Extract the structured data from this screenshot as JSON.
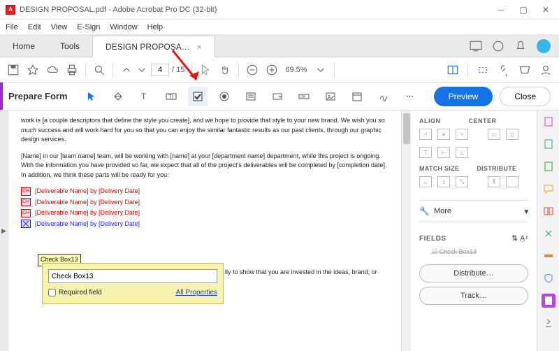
{
  "window": {
    "title": "DESIGN PROPOSAL.pdf - Adobe Acrobat Pro DC (32-bit)"
  },
  "menu": {
    "file": "File",
    "edit": "Edit",
    "view": "View",
    "esign": "E-Sign",
    "window": "Window",
    "help": "Help"
  },
  "tabs": {
    "home": "Home",
    "tools": "Tools",
    "doc": "DESIGN PROPOSA…"
  },
  "page": {
    "current": "4",
    "total": "/ 15",
    "zoom": "69.5%"
  },
  "formbar": {
    "title": "Prepare Form",
    "preview": "Preview",
    "close": "Close"
  },
  "doc": {
    "p1": "work is [a couple descriptors that define the style you create], and we hope to provide that style to your new brand. We wish you ",
    "p1em": "so much",
    "p1b": " success and will work hard for you so that you can enjoy the similar fantastic results as our past clients, through our graphic design services.",
    "p2": "[Name] in our [team name] team, will be working with [name] at your [department name] department, while this project is ongoing. With the information you have provided so far, we expect that all of the project's deliverables will be completed by [completion date]. In addition, we think these parts will be ready for you:",
    "deliv": "[Deliverable Name] by [Delivery Date]",
    "chk": "CH",
    "p3": "lly to show that you are invested in the ideas, brand, or"
  },
  "tooltip": {
    "label": "Check Box13"
  },
  "prop": {
    "name": "Check Box13",
    "req": "Required field",
    "all": "All Properties"
  },
  "right": {
    "align": "ALIGN",
    "center": "CENTER",
    "match": "MATCH SIZE",
    "dist": "DISTRIBUTE",
    "more": "More",
    "fields": "FIELDS",
    "fieldrow": "Check Box13",
    "distribute": "Distribute…",
    "track": "Track…"
  }
}
